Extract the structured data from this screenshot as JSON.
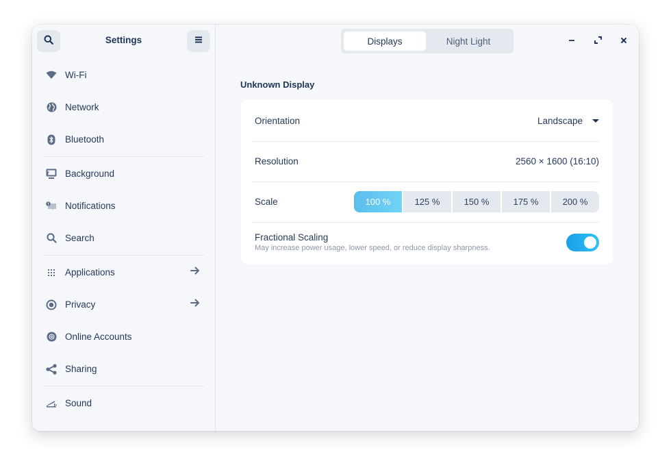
{
  "sidebar": {
    "title": "Settings",
    "search_icon": "search-icon",
    "menu_icon": "hamburger-menu-icon",
    "items": [
      {
        "label": "Wi-Fi",
        "icon": "wifi-icon"
      },
      {
        "label": "Network",
        "icon": "globe-icon"
      },
      {
        "label": "Bluetooth",
        "icon": "bluetooth-icon"
      },
      {
        "label": "Background",
        "icon": "monitor-icon"
      },
      {
        "label": "Notifications",
        "icon": "notification-icon"
      },
      {
        "label": "Search",
        "icon": "search-icon"
      },
      {
        "label": "Applications",
        "icon": "apps-grid-icon",
        "has_arrow": true
      },
      {
        "label": "Privacy",
        "icon": "privacy-icon",
        "has_arrow": true
      },
      {
        "label": "Online Accounts",
        "icon": "at-sign-icon"
      },
      {
        "label": "Sharing",
        "icon": "share-icon"
      },
      {
        "label": "Sound",
        "icon": "sound-icon"
      }
    ]
  },
  "header": {
    "tabs": [
      {
        "label": "Displays",
        "active": true
      },
      {
        "label": "Night Light",
        "active": false
      }
    ],
    "window_controls": [
      "minimize-icon",
      "maximize-icon",
      "close-icon"
    ]
  },
  "main": {
    "section_title": "Unknown Display",
    "orientation": {
      "label": "Orientation",
      "value": "Landscape"
    },
    "resolution": {
      "label": "Resolution",
      "value": "2560 × 1600 (16:10)"
    },
    "scale": {
      "label": "Scale",
      "options": [
        "100 %",
        "125 %",
        "150 %",
        "175 %",
        "200 %"
      ],
      "selected": "100 %"
    },
    "fractional_scaling": {
      "title": "Fractional Scaling",
      "subtitle": "May increase power usage, lower speed, or reduce display sharpness.",
      "enabled": true
    }
  },
  "colors": {
    "accent": "#1aa0e8",
    "scale_selected": "#5bbdeb",
    "text_primary": "#1d3557",
    "window_bg": "#f5f7fb"
  }
}
